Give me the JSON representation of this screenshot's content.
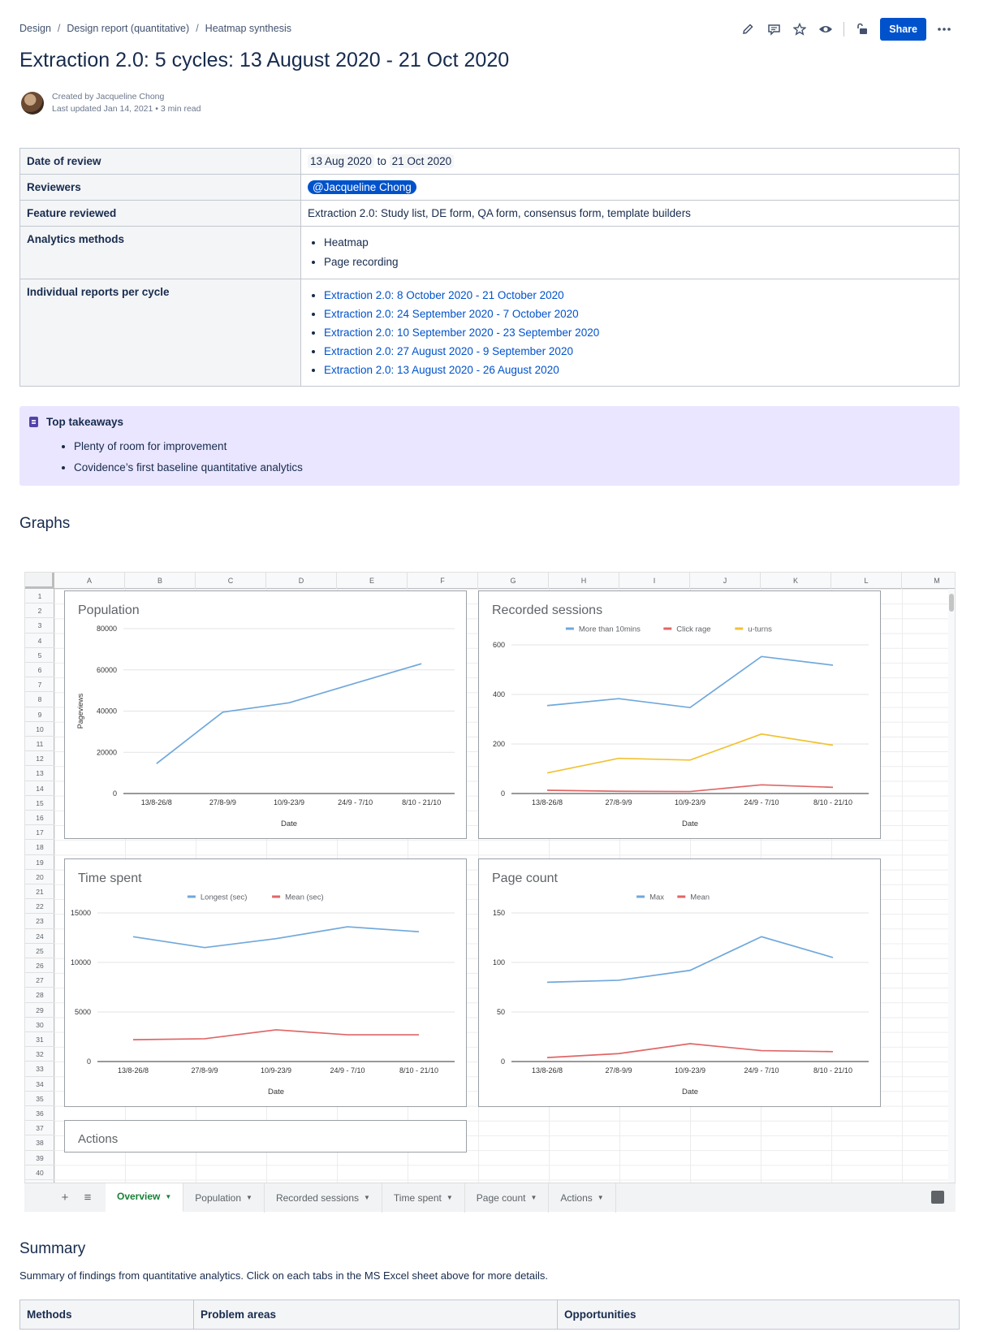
{
  "breadcrumb": [
    "Design",
    "Design report (quantitative)",
    "Heatmap synthesis"
  ],
  "toolbar": {
    "share_label": "Share"
  },
  "page": {
    "title": "Extraction 2.0: 5 cycles: 13 August 2020 - 21 Oct 2020",
    "created_by": "Created by Jacqueline Chong",
    "last_updated": "Last updated Jan 14, 2021 •",
    "read_time": "3 min read"
  },
  "info": {
    "date_label": "Date of review",
    "date_from": "13 Aug 2020",
    "date_to_word": "to",
    "date_to": "21 Oct 2020",
    "reviewers_label": "Reviewers",
    "reviewer": "@Jacqueline Chong",
    "feature_label": "Feature reviewed",
    "feature": "Extraction 2.0: Study list, DE form, QA form, consensus form, template builders",
    "methods_label": "Analytics methods",
    "methods": [
      "Heatmap",
      "Page recording"
    ],
    "reports_label": "Individual reports per cycle",
    "reports": [
      "Extraction 2.0: 8 October 2020 - 21 October 2020",
      "Extraction 2.0: 24 September 2020 - 7 October 2020",
      "Extraction 2.0: 10 September 2020 - 23 September 2020",
      "Extraction 2.0: 27 August 2020 - 9 September 2020",
      "Extraction 2.0: 13 August 2020 - 26 August 2020"
    ]
  },
  "takeaways": {
    "title": "Top takeaways",
    "items": [
      "Plenty of room for improvement",
      "Covidence’s first baseline quantitative analytics"
    ]
  },
  "graphs_heading": "Graphs",
  "sheet": {
    "columns": [
      "A",
      "B",
      "C",
      "D",
      "E",
      "F",
      "G",
      "H",
      "I",
      "J",
      "K",
      "L",
      "M"
    ],
    "rows": [
      "1",
      "2",
      "3",
      "4",
      "5",
      "6",
      "7",
      "8",
      "9",
      "10",
      "11",
      "12",
      "13",
      "14",
      "15",
      "16",
      "17",
      "18",
      "19",
      "20",
      "21",
      "22",
      "23",
      "24",
      "25",
      "26",
      "27",
      "28",
      "29",
      "30",
      "31",
      "32",
      "33",
      "34",
      "35",
      "36",
      "37",
      "38",
      "39",
      "40"
    ],
    "actions_peek": "Actions",
    "tabs": [
      "Overview",
      "Population",
      "Recorded sessions",
      "Time spent",
      "Page count",
      "Actions"
    ]
  },
  "chart_data": [
    {
      "type": "line",
      "title": "Population",
      "categories": [
        "13/8-26/8",
        "27/8-9/9",
        "10/9-23/9",
        "24/9 - 7/10",
        "8/10 - 21/10"
      ],
      "series": [
        {
          "values": [
            14500,
            39500,
            44000,
            53500,
            63000
          ],
          "color": "#6fa8dc"
        }
      ],
      "xlabel": "Date",
      "ylabel": "Pageviews",
      "ylim": [
        0,
        80000
      ],
      "yticks": [
        0,
        20000,
        40000,
        60000,
        80000
      ],
      "legend": "none",
      "grid": true
    },
    {
      "type": "line",
      "title": "Recorded sessions",
      "categories": [
        "13/8-26/8",
        "27/8-9/9",
        "10/9-23/9",
        "24/9 - 7/10",
        "8/10 - 21/10"
      ],
      "series": [
        {
          "name": "More than 10mins",
          "values": [
            355,
            383,
            347,
            553,
            518
          ],
          "color": "#6fa8dc"
        },
        {
          "name": "Click rage",
          "values": [
            13,
            9,
            8,
            35,
            25
          ],
          "color": "#e06666"
        },
        {
          "name": "u-turns",
          "values": [
            83,
            142,
            135,
            240,
            195
          ],
          "color": "#f1c232"
        }
      ],
      "xlabel": "Date",
      "ylabel": "",
      "ylim": [
        0,
        600
      ],
      "yticks": [
        0,
        200,
        400,
        600
      ],
      "legend": "top",
      "grid": true
    },
    {
      "type": "line",
      "title": "Time spent",
      "categories": [
        "13/8-26/8",
        "27/8-9/9",
        "10/9-23/9",
        "24/9 - 7/10",
        "8/10 - 21/10"
      ],
      "series": [
        {
          "name": "Longest (sec)",
          "values": [
            12600,
            11500,
            12400,
            13600,
            13100
          ],
          "color": "#6fa8dc"
        },
        {
          "name": "Mean (sec)",
          "values": [
            2200,
            2300,
            3200,
            2700,
            2700
          ],
          "color": "#e06666"
        }
      ],
      "xlabel": "Date",
      "ylabel": "",
      "ylim": [
        0,
        15000
      ],
      "yticks": [
        0,
        5000,
        10000,
        15000
      ],
      "legend": "top",
      "grid": true
    },
    {
      "type": "line",
      "title": "Page count",
      "categories": [
        "13/8-26/8",
        "27/8-9/9",
        "10/9-23/9",
        "24/9 - 7/10",
        "8/10 - 21/10"
      ],
      "series": [
        {
          "name": "Max",
          "values": [
            80,
            82,
            92,
            126,
            105
          ],
          "color": "#6fa8dc"
        },
        {
          "name": "Mean",
          "values": [
            4,
            8,
            18,
            11,
            10
          ],
          "color": "#e06666"
        }
      ],
      "xlabel": "Date",
      "ylabel": "",
      "ylim": [
        0,
        150
      ],
      "yticks": [
        0,
        50,
        100,
        150
      ],
      "legend": "top",
      "grid": true
    }
  ],
  "summary": {
    "heading": "Summary",
    "text": "Summary of findings from quantitative analytics. Click on each tabs in the MS Excel sheet above for more details.",
    "columns": [
      "Methods",
      "Problem areas",
      "Opportunities"
    ]
  }
}
